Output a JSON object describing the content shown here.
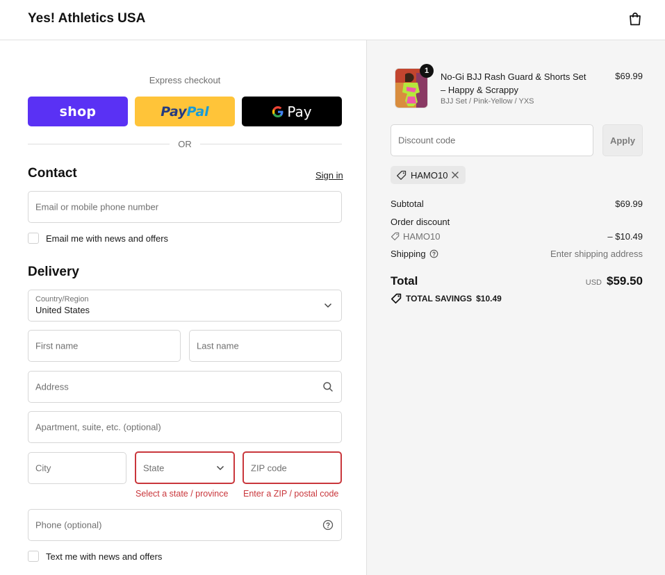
{
  "header": {
    "brand": "Yes! Athletics USA",
    "bag_icon": "shopping-bag-icon"
  },
  "express": {
    "title": "Express checkout",
    "shop_label": "shop",
    "paypal_label_1": "Pay",
    "paypal_label_2": "Pal",
    "gpay_label": "Pay",
    "or_label": "OR"
  },
  "contact": {
    "title": "Contact",
    "sign_in": "Sign in",
    "email_placeholder": "Email or mobile phone number",
    "news_label": "Email me with news and offers"
  },
  "delivery": {
    "title": "Delivery",
    "country_label": "Country/Region",
    "country_value": "United States",
    "first_name": "First name",
    "last_name": "Last name",
    "address": "Address",
    "apartment": "Apartment, suite, etc. (optional)",
    "city": "City",
    "state": "State",
    "state_error": "Select a state / province",
    "zip": "ZIP code",
    "zip_error": "Enter a ZIP / postal code",
    "phone": "Phone (optional)",
    "text_label": "Text me with news and offers"
  },
  "summary": {
    "product": {
      "name": "No-Gi BJJ Rash Guard & Shorts Set – Happy & Scrappy",
      "variant": "BJJ Set / Pink-Yellow / YXS",
      "price": "$69.99",
      "qty": "1"
    },
    "discount_placeholder": "Discount code",
    "apply_label": "Apply",
    "applied_code": "HAMO10",
    "subtotal_label": "Subtotal",
    "subtotal_value": "$69.99",
    "order_discount_label": "Order discount",
    "order_discount_code": "HAMO10",
    "order_discount_value": "– $10.49",
    "shipping_label": "Shipping",
    "shipping_value": "Enter shipping address",
    "total_label": "Total",
    "total_currency": "USD",
    "total_value": "$59.50",
    "savings_label": "TOTAL SAVINGS",
    "savings_value": "$10.49"
  },
  "colors": {
    "shop_purple": "#5a31f4",
    "paypal_yellow": "#ffc439",
    "error_red": "#c9363b",
    "panel_gray": "#f5f5f5"
  }
}
